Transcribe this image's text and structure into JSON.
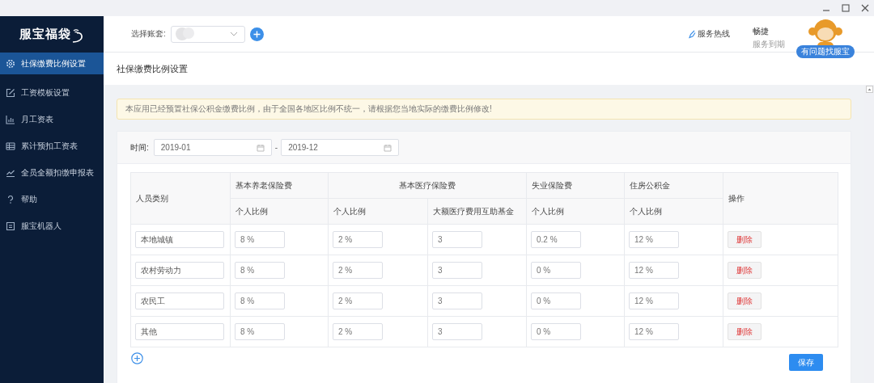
{
  "logo": "服宝福袋",
  "sidebar": {
    "items": [
      {
        "label": "社保缴费比例设置",
        "kind": "gear",
        "selected": true
      },
      {
        "label": "工资模板设置",
        "kind": "edit",
        "selected": false
      },
      {
        "label": "月工资表",
        "kind": "bars",
        "selected": false
      },
      {
        "label": "累计预扣工资表",
        "kind": "grid",
        "selected": false
      },
      {
        "label": "全员全额扣缴申报表",
        "kind": "trend",
        "selected": false
      },
      {
        "label": "帮助",
        "kind": "help",
        "selected": false
      },
      {
        "label": "服宝机器人",
        "kind": "robot",
        "selected": false
      }
    ]
  },
  "header": {
    "account_label": "选择账套:",
    "hotline": "服务热线",
    "service_name": "畅捷",
    "expiry_note": "服务到期",
    "help_badge": "有问题找服宝"
  },
  "page_title": "社保缴费比例设置",
  "notice": "本应用已经预置社保公积金缴费比例，由于全国各地区比例不统一，请根据您当地实际的缴费比例修改!",
  "filter": {
    "label": "时间:",
    "start": "2019-01",
    "separator": "-",
    "end": "2019-12"
  },
  "table": {
    "columns": [
      {
        "group": "人员类别"
      },
      {
        "group": "基本养老保险费",
        "subs": [
          "个人比例"
        ]
      },
      {
        "group": "基本医疗保险费",
        "subs": [
          "个人比例",
          "大额医疗费用互助基金"
        ]
      },
      {
        "group": "失业保险费",
        "subs": [
          "个人比例"
        ]
      },
      {
        "group": "住房公积金",
        "subs": [
          "个人比例"
        ]
      },
      {
        "group": "操作"
      }
    ],
    "rows": [
      {
        "category": "本地城镇",
        "values": [
          "8 %",
          "2 %",
          "3",
          "0.2 %",
          "12 %"
        ],
        "action": "删除"
      },
      {
        "category": "农村劳动力",
        "values": [
          "8 %",
          "2 %",
          "3",
          "0 %",
          "12 %"
        ],
        "action": "删除"
      },
      {
        "category": "农民工",
        "values": [
          "8 %",
          "2 %",
          "3",
          "0 %",
          "12 %"
        ],
        "action": "删除"
      },
      {
        "category": "其他",
        "values": [
          "8 %",
          "2 %",
          "3",
          "0 %",
          "12 %"
        ],
        "action": "删除"
      }
    ]
  },
  "save_button": "保存"
}
